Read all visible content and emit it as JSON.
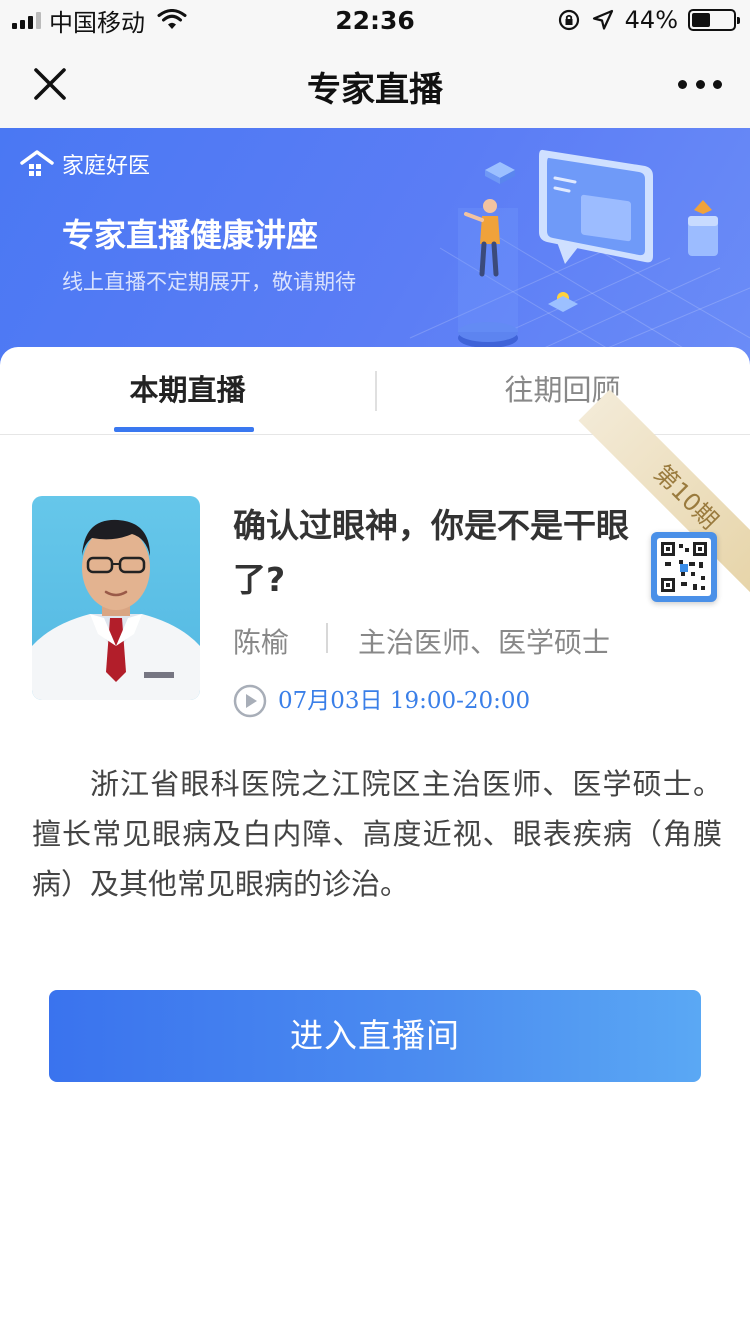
{
  "status_bar": {
    "carrier": "中国移动",
    "time": "22:36",
    "battery_percent": "44%",
    "battery_level": 0.44
  },
  "nav": {
    "title": "专家直播"
  },
  "banner": {
    "logo_text": "家庭好医",
    "title": "专家直播健康讲座",
    "subtitle": "线上直播不定期展开，敬请期待"
  },
  "tabs": {
    "current": "本期直播",
    "past": "往期回顾"
  },
  "lecture": {
    "issue_badge": "第10期",
    "title": "确认过眼神，你是不是干眼了?",
    "doctor_name": "陈榆",
    "doctor_title": "主治医师、医学硕士",
    "time": "07月03日 19:00-20:00",
    "description": "浙江省眼科医院之江院区主治医师、医学硕士。 擅长常见眼病及白内障、高度近视、眼表疾病（角膜病）及其他常见眼病的诊治。"
  },
  "actions": {
    "enter_label": "进入直播间"
  },
  "colors": {
    "accent": "#3a78f0",
    "banner": "#5b7df5",
    "time_text": "#3a7fe8"
  }
}
